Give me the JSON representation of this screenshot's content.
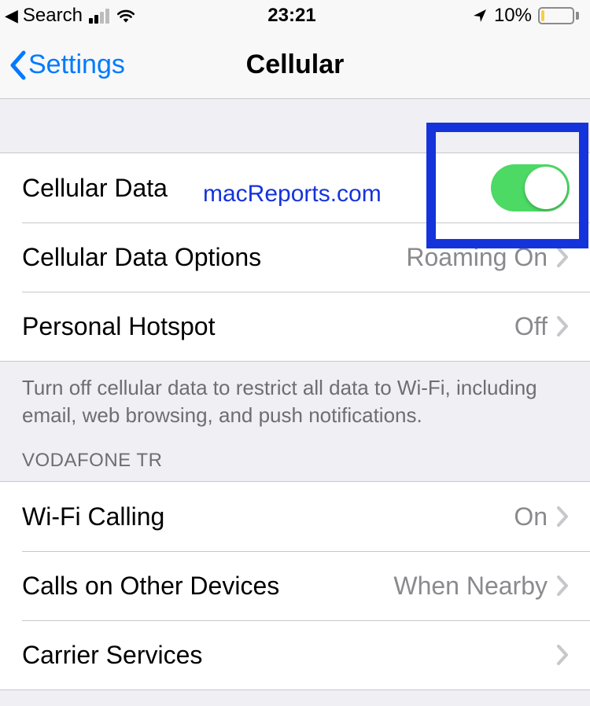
{
  "status": {
    "back_app": "Search",
    "time": "23:21",
    "battery_percent": "10%"
  },
  "nav": {
    "back_label": "Settings",
    "title": "Cellular"
  },
  "overlay": "macReports.com",
  "section1": {
    "cellular_data_label": "Cellular Data",
    "cellular_data_on": true,
    "data_options_label": "Cellular Data Options",
    "data_options_value": "Roaming On",
    "hotspot_label": "Personal Hotspot",
    "hotspot_value": "Off"
  },
  "footer_note": "Turn off cellular data to restrict all data to Wi-Fi, including email, web browsing, and push notifications.",
  "section2_header": "VODAFONE TR",
  "section2": {
    "wifi_calling_label": "Wi-Fi Calling",
    "wifi_calling_value": "On",
    "other_devices_label": "Calls on Other Devices",
    "other_devices_value": "When Nearby",
    "carrier_services_label": "Carrier Services"
  }
}
